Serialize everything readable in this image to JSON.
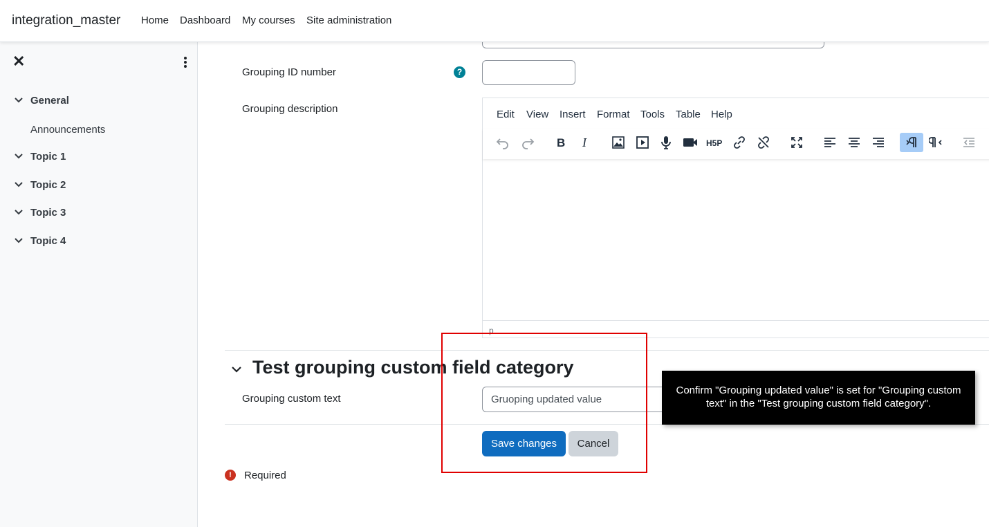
{
  "navbar": {
    "brand": "integration_master",
    "links": [
      "Home",
      "Dashboard",
      "My courses",
      "Site administration"
    ]
  },
  "drawer": {
    "close_icon": "close-icon",
    "more_icon": "kebab-menu-icon",
    "sections": [
      {
        "label": "General",
        "items": [
          "Announcements"
        ]
      },
      {
        "label": "Topic 1",
        "items": []
      },
      {
        "label": "Topic 2",
        "items": []
      },
      {
        "label": "Topic 3",
        "items": []
      },
      {
        "label": "Topic 4",
        "items": []
      }
    ]
  },
  "form": {
    "grouping_id_label": "Grouping ID number",
    "grouping_id_value": "",
    "grouping_description_label": "Grouping description",
    "editor": {
      "menus": [
        "Edit",
        "View",
        "Insert",
        "Format",
        "Tools",
        "Table",
        "Help"
      ],
      "toolbar_icons": [
        "undo-icon",
        "redo-icon",
        "bold-icon",
        "italic-icon",
        "image-icon",
        "media-icon",
        "record-audio-icon",
        "record-video-icon",
        "h5p-icon",
        "link-icon",
        "unlink-icon",
        "fullscreen-icon",
        "align-left-icon",
        "align-center-icon",
        "align-right-icon",
        "ltr-icon",
        "rtl-icon",
        "outdent-icon"
      ],
      "h5p_label": "H5P",
      "status_path": "p"
    },
    "custom_category_heading": "Test grouping custom field category",
    "custom_text_label": "Grouping custom text",
    "custom_text_value": "Gruoping updated value",
    "save_label": "Save changes",
    "cancel_label": "Cancel",
    "required_label": "Required"
  },
  "tooltip": {
    "text": "Confirm \"Grouping updated value\" is set for \"Grouping custom text\" in the \"Test grouping custom field category\"."
  },
  "colors": {
    "primary": "#0f6cbf",
    "help": "#008196",
    "required": "#ca3120",
    "highlight": "#e00000",
    "active_tool": "#a6ccf7"
  }
}
